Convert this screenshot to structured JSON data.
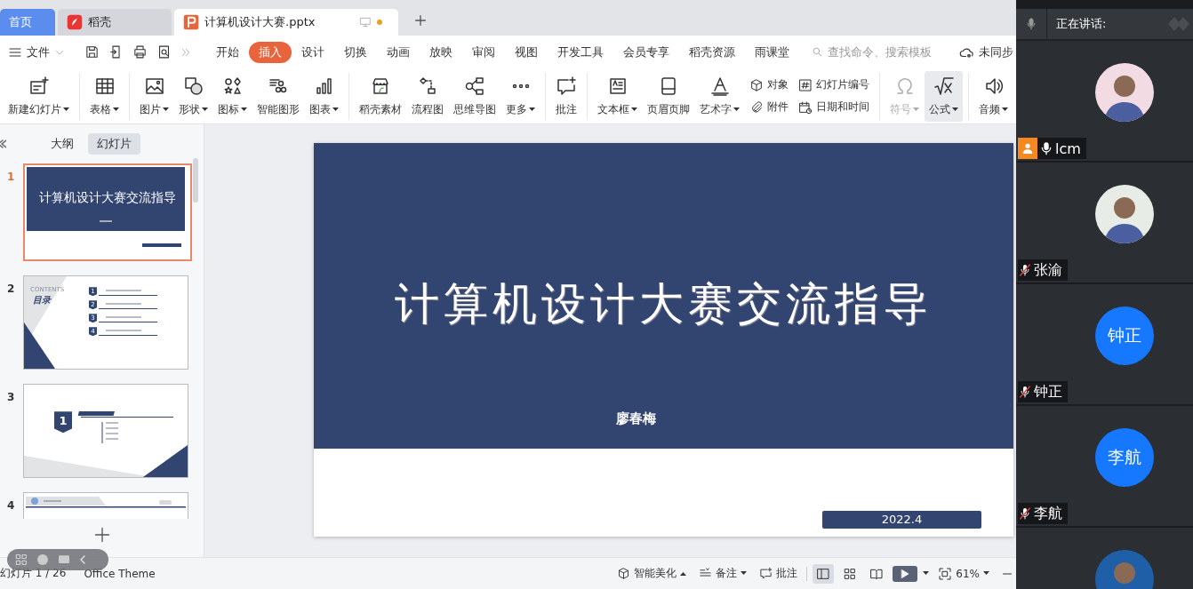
{
  "tabs": [
    {
      "label": "首页",
      "kind": "home",
      "selected": false
    },
    {
      "label": "稻壳",
      "kind": "docer",
      "selected": false
    },
    {
      "label": "计算机设计大赛.pptx",
      "kind": "file",
      "selected": true,
      "unsaved": true
    }
  ],
  "menu": {
    "file_label": "文件",
    "items": [
      {
        "label": "开始",
        "selected": false
      },
      {
        "label": "插入",
        "selected": true
      },
      {
        "label": "设计",
        "selected": false
      },
      {
        "label": "切换",
        "selected": false
      },
      {
        "label": "动画",
        "selected": false
      },
      {
        "label": "放映",
        "selected": false
      },
      {
        "label": "审阅",
        "selected": false
      },
      {
        "label": "视图",
        "selected": false
      },
      {
        "label": "开发工具",
        "selected": false
      },
      {
        "label": "会员专享",
        "selected": false
      },
      {
        "label": "稻壳资源",
        "selected": false
      },
      {
        "label": "雨课堂",
        "selected": false
      }
    ],
    "search_placeholder": "查找命令、搜索模板",
    "sync_label": "未同步"
  },
  "ribbon": [
    [
      {
        "kind": "large",
        "label": "新建幻灯片",
        "dropdown": true,
        "disabled": false,
        "highlighted": false
      }
    ],
    [
      {
        "kind": "large",
        "label": "表格",
        "dropdown": true,
        "disabled": false,
        "highlighted": false
      }
    ],
    [
      {
        "kind": "large",
        "label": "图片",
        "dropdown": true,
        "disabled": false,
        "highlighted": false
      },
      {
        "kind": "large",
        "label": "形状",
        "dropdown": true,
        "disabled": false,
        "highlighted": false
      },
      {
        "kind": "large",
        "label": "图标",
        "dropdown": true,
        "disabled": false,
        "highlighted": false
      },
      {
        "kind": "large",
        "label": "智能图形",
        "dropdown": false,
        "disabled": false,
        "highlighted": false
      },
      {
        "kind": "large",
        "label": "图表",
        "dropdown": true,
        "disabled": false,
        "highlighted": false
      }
    ],
    [
      {
        "kind": "large",
        "label": "稻壳素材",
        "dropdown": false,
        "disabled": false,
        "highlighted": false
      },
      {
        "kind": "large",
        "label": "流程图",
        "dropdown": false,
        "disabled": false,
        "highlighted": false
      },
      {
        "kind": "large",
        "label": "思维导图",
        "dropdown": false,
        "disabled": false,
        "highlighted": false
      },
      {
        "kind": "large",
        "label": "更多",
        "dropdown": true,
        "disabled": false,
        "highlighted": false
      }
    ],
    [
      {
        "kind": "large",
        "label": "批注",
        "dropdown": false,
        "disabled": false,
        "highlighted": false
      }
    ],
    [
      {
        "kind": "large",
        "label": "文本框",
        "dropdown": true,
        "disabled": false,
        "highlighted": false
      },
      {
        "kind": "large",
        "label": "页眉页脚",
        "dropdown": false,
        "disabled": false,
        "highlighted": false
      },
      {
        "kind": "large",
        "label": "艺术字",
        "dropdown": true,
        "disabled": false,
        "highlighted": false
      },
      {
        "kind": "pair",
        "items": [
          {
            "label": "对象"
          },
          {
            "label": "附件"
          }
        ]
      },
      {
        "kind": "pair",
        "items": [
          {
            "label": "幻灯片编号"
          },
          {
            "label": "日期和时间"
          }
        ]
      }
    ],
    [
      {
        "kind": "large",
        "label": "符号",
        "dropdown": true,
        "disabled": true,
        "highlighted": false
      },
      {
        "kind": "large",
        "label": "公式",
        "dropdown": true,
        "disabled": false,
        "highlighted": true
      }
    ],
    [
      {
        "kind": "large",
        "label": "音频",
        "dropdown": true,
        "disabled": false,
        "highlighted": false
      }
    ]
  ],
  "slide_panel": {
    "tabs": [
      {
        "label": "大纲",
        "selected": false
      },
      {
        "label": "幻灯片",
        "selected": true
      }
    ],
    "slides": [
      {
        "number": "1",
        "kind": "title",
        "selected": true,
        "title": "计算机设计大赛交流指导"
      },
      {
        "number": "2",
        "kind": "contents",
        "selected": false,
        "heading": "CONTENTS",
        "subheading": "目录",
        "markers": [
          "1",
          "2",
          "3",
          "4"
        ]
      },
      {
        "number": "3",
        "kind": "section",
        "selected": false,
        "marker": "1"
      },
      {
        "number": "4",
        "kind": "intro",
        "selected": false
      }
    ]
  },
  "slide": {
    "title": "计算机设计大赛交流指导",
    "author": "廖春梅",
    "date": "2022.4"
  },
  "status_bar": {
    "slide_counter": "幻灯片 1 / 26",
    "theme": "Office Theme",
    "beautify": "智能美化",
    "notes": "备注",
    "comments": "批注",
    "view_modes": [
      {
        "kind": "normal",
        "selected": true
      },
      {
        "kind": "sorter",
        "selected": false
      },
      {
        "kind": "reading",
        "selected": false
      }
    ],
    "zoom": "61%"
  },
  "meeting": {
    "header": "正在讲话:",
    "participants": [
      {
        "name": "lcm",
        "host": true,
        "muted": false,
        "kind": "image"
      },
      {
        "name": "张渝",
        "host": false,
        "muted": true,
        "kind": "image"
      },
      {
        "name": "钟正",
        "host": false,
        "muted": true,
        "kind": "initials",
        "avatar_text": "钟正"
      },
      {
        "name": "李航",
        "host": false,
        "muted": true,
        "kind": "initials",
        "avatar_text": "李航"
      },
      {
        "host": false,
        "kind": "image"
      }
    ]
  }
}
